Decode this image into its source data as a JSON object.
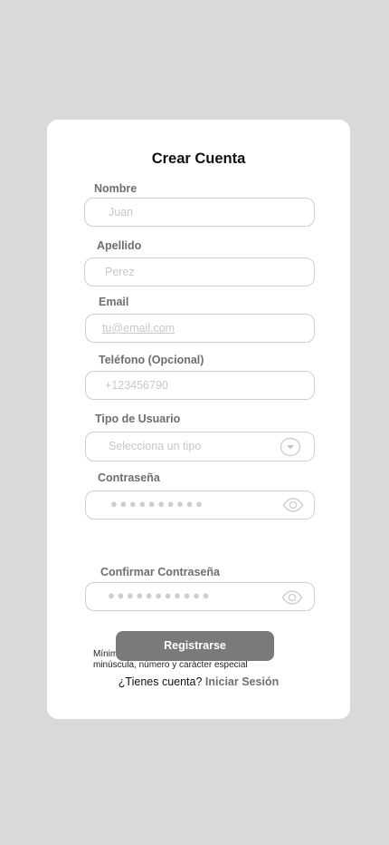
{
  "form": {
    "title": "Crear Cuenta",
    "nombre": {
      "label": "Nombre",
      "placeholder": "Juan"
    },
    "apellido": {
      "label": "Apellido",
      "placeholder": "Perez"
    },
    "email": {
      "label": "Email",
      "placeholder": "tu@email.com"
    },
    "telefono": {
      "label": "Teléfono (Opcional)",
      "placeholder": "+123456790"
    },
    "tipo_usuario": {
      "label": "Tipo de Usuario",
      "selected": "Selecciona un tipo",
      "icon": "chevron-down-icon"
    },
    "contrasena": {
      "label": "Contraseña",
      "masked_value": "●●●●●●●●●●",
      "icon": "eye-icon"
    },
    "password_hint": "Mínimo 6 caracteres, incluye mayúscula, minúscula, número y carácter especial",
    "confirmar_contrasena": {
      "label": "Confirmar Contraseña",
      "masked_value": "●●●●●●●●●●●",
      "icon": "eye-icon"
    },
    "submit_label": "Registrarse",
    "footer_text": "¿Tienes cuenta?",
    "login_link": "Iniciar Sesión"
  },
  "colors": {
    "background": "#d9d9d9",
    "card": "#ffffff",
    "button": "#7a7a7a",
    "field_border": "#cfcfcf",
    "placeholder": "#c8c8c8"
  }
}
